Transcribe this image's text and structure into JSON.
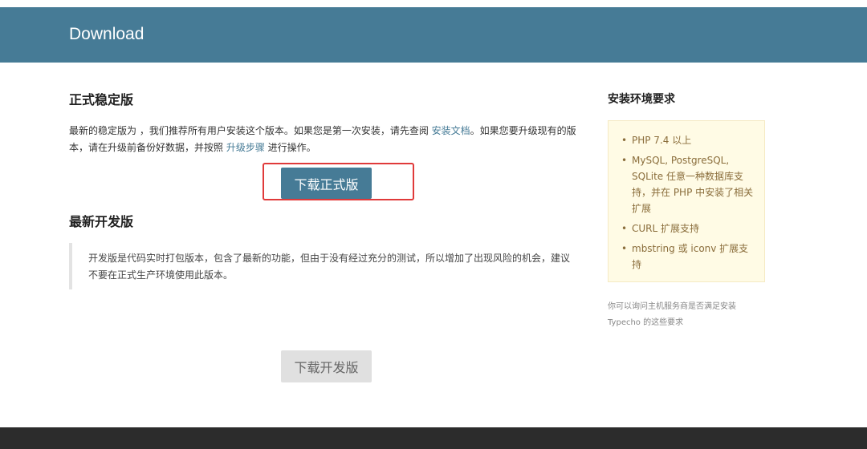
{
  "header": {
    "title": "Download"
  },
  "stable": {
    "heading": "正式稳定版",
    "desc_part1": "最新的稳定版为 ，我们推荐所有用户安装这个版本。如果您是第一次安装，请先查阅 ",
    "link_install_docs": "安装文档",
    "desc_part2": "。如果您要升级现有的版本，请在升级前备份好数据，并按照 ",
    "link_upgrade_steps": "升级步骤",
    "desc_part3": " 进行操作。",
    "button_label": "下载正式版"
  },
  "dev": {
    "heading": "最新开发版",
    "desc": "开发版是代码实时打包版本，包含了最新的功能，但由于没有经过充分的测试，所以增加了出现风险的机会，建议不要在正式生产环境使用此版本。",
    "button_label": "下载开发版"
  },
  "requirements": {
    "heading": "安装环境要求",
    "items": [
      "PHP 7.4 以上",
      "MySQL, PostgreSQL, SQLite 任意一种数据库支持，并在 PHP 中安装了相关扩展",
      "CURL 扩展支持",
      "mbstring 或 iconv 扩展支持"
    ],
    "note": "你可以询问主机服务商是否满足安装 Typecho 的这些要求"
  },
  "colors": {
    "header_bg": "#467b96",
    "primary_button": "#467b96",
    "secondary_button": "#e0e0e0",
    "highlight_border": "#e03a3a",
    "requirements_bg": "#fffbe5",
    "footer_bg": "#2c2c2c"
  }
}
